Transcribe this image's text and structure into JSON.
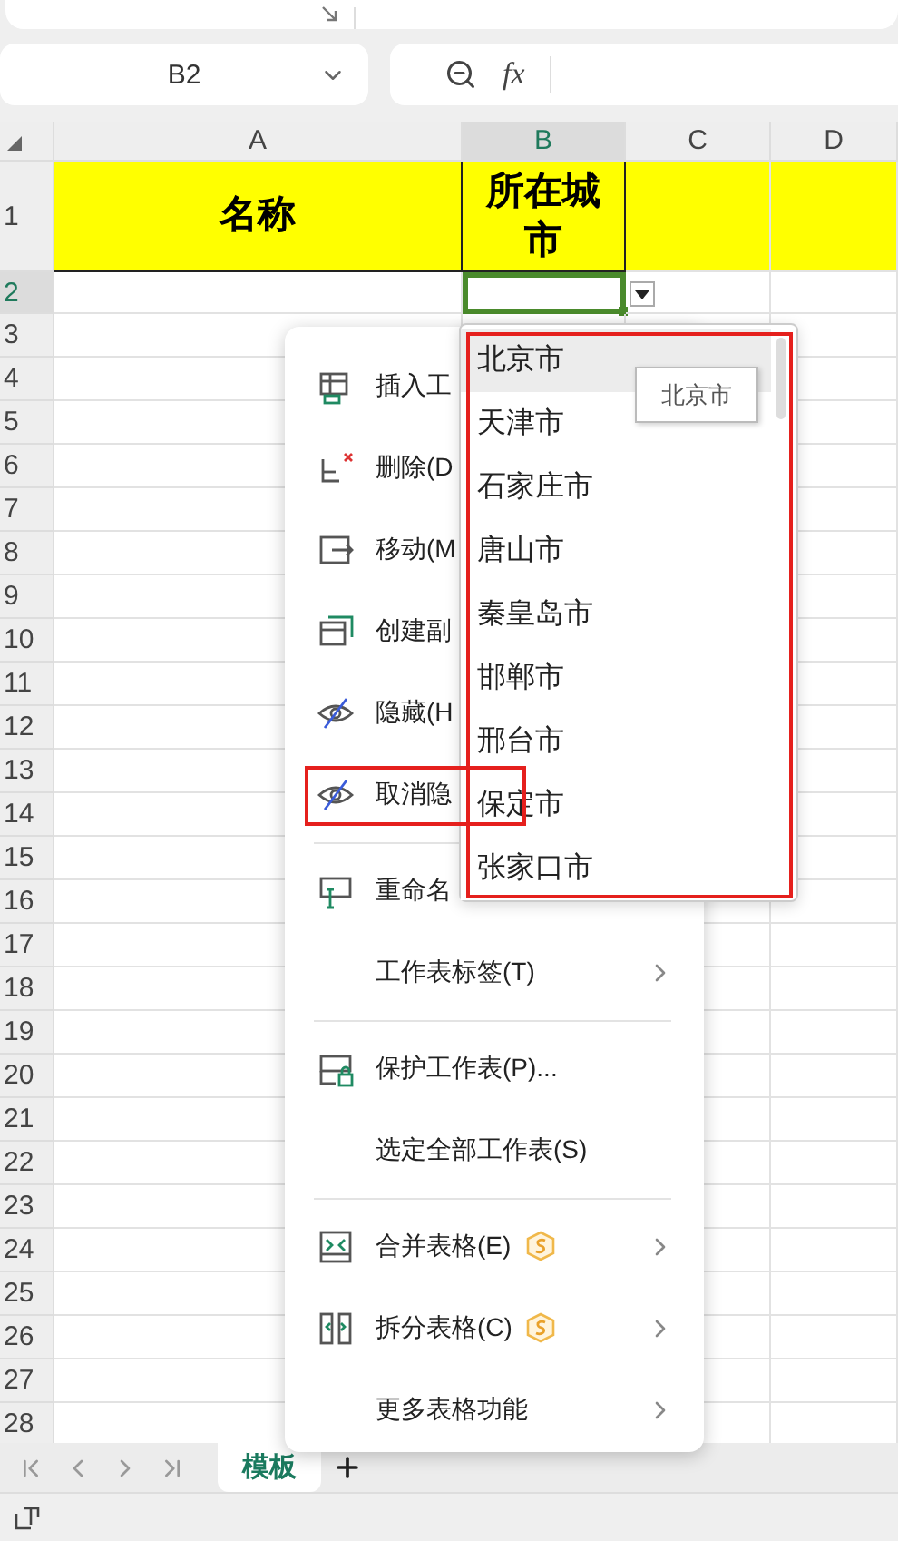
{
  "formula_bar": {
    "cell_ref": "B2",
    "function_label": "fx"
  },
  "columns": [
    {
      "label": "A",
      "selected": false
    },
    {
      "label": "B",
      "selected": true
    },
    {
      "label": "C",
      "selected": false
    },
    {
      "label": "D",
      "selected": false
    }
  ],
  "rows": [
    {
      "label": "1",
      "selected": false,
      "color": "#ffff00",
      "cells": [
        "名称",
        "所在城市"
      ]
    },
    {
      "label": "2",
      "selected": true
    },
    {
      "label": "3",
      "selected": false
    },
    {
      "label": "4",
      "selected": false
    },
    {
      "label": "5",
      "selected": false
    },
    {
      "label": "6",
      "selected": false
    },
    {
      "label": "7",
      "selected": false
    },
    {
      "label": "8",
      "selected": false
    },
    {
      "label": "9",
      "selected": false
    },
    {
      "label": "10",
      "selected": false
    },
    {
      "label": "11",
      "selected": false
    },
    {
      "label": "12",
      "selected": false
    },
    {
      "label": "13",
      "selected": false
    },
    {
      "label": "14",
      "selected": false
    },
    {
      "label": "15",
      "selected": false
    },
    {
      "label": "16",
      "selected": false
    },
    {
      "label": "17",
      "selected": false
    },
    {
      "label": "18",
      "selected": false
    },
    {
      "label": "19",
      "selected": false
    },
    {
      "label": "20",
      "selected": false
    },
    {
      "label": "21",
      "selected": false
    },
    {
      "label": "22",
      "selected": false
    },
    {
      "label": "23",
      "selected": false
    },
    {
      "label": "24",
      "selected": false
    },
    {
      "label": "25",
      "selected": false
    },
    {
      "label": "26",
      "selected": false
    },
    {
      "label": "27",
      "selected": false
    },
    {
      "label": "28",
      "selected": false
    }
  ],
  "context_menu": {
    "items": [
      {
        "kind": "item",
        "label": "插入工",
        "annotated": false
      },
      {
        "kind": "item",
        "label": "删除(D",
        "annotated": false
      },
      {
        "kind": "item",
        "label": "移动(M",
        "annotated": false
      },
      {
        "kind": "item",
        "label": "创建副",
        "annotated": false
      },
      {
        "kind": "item",
        "label": "隐藏(H",
        "annotated": false
      },
      {
        "kind": "item",
        "label": "取消隐",
        "annotated": true
      },
      {
        "kind": "separator"
      },
      {
        "kind": "item",
        "label": "重命名",
        "annotated": false
      },
      {
        "kind": "item",
        "label": "工作表标签(T)",
        "submenu": true,
        "premium": false,
        "annotated": false
      },
      {
        "kind": "separator"
      },
      {
        "kind": "item",
        "label": "保护工作表(P)...",
        "submenu": false,
        "premium": false,
        "annotated": false
      },
      {
        "kind": "item",
        "label": "选定全部工作表(S)",
        "submenu": false,
        "premium": false,
        "annotated": false
      },
      {
        "kind": "separator"
      },
      {
        "kind": "item",
        "label": "合并表格(E)",
        "submenu": true,
        "premium": true,
        "annotated": false
      },
      {
        "kind": "item",
        "label": "拆分表格(C)",
        "submenu": true,
        "premium": true,
        "annotated": false
      },
      {
        "kind": "item",
        "label": "更多表格功能",
        "submenu": true,
        "premium": false,
        "annotated": false
      }
    ]
  },
  "validation_list": {
    "annotated": true,
    "tooltip": "北京市",
    "options": [
      {
        "label": "北京市",
        "selected": true
      },
      {
        "label": "天津市",
        "selected": false
      },
      {
        "label": "石家庄市",
        "selected": false
      },
      {
        "label": "唐山市",
        "selected": false
      },
      {
        "label": "秦皇岛市",
        "selected": false
      },
      {
        "label": "邯郸市",
        "selected": false
      },
      {
        "label": "邢台市",
        "selected": false
      },
      {
        "label": "保定市",
        "selected": false
      },
      {
        "label": "张家口市",
        "selected": false
      }
    ]
  },
  "sheet_tabs": [
    {
      "label": "模板",
      "selected": true
    }
  ]
}
